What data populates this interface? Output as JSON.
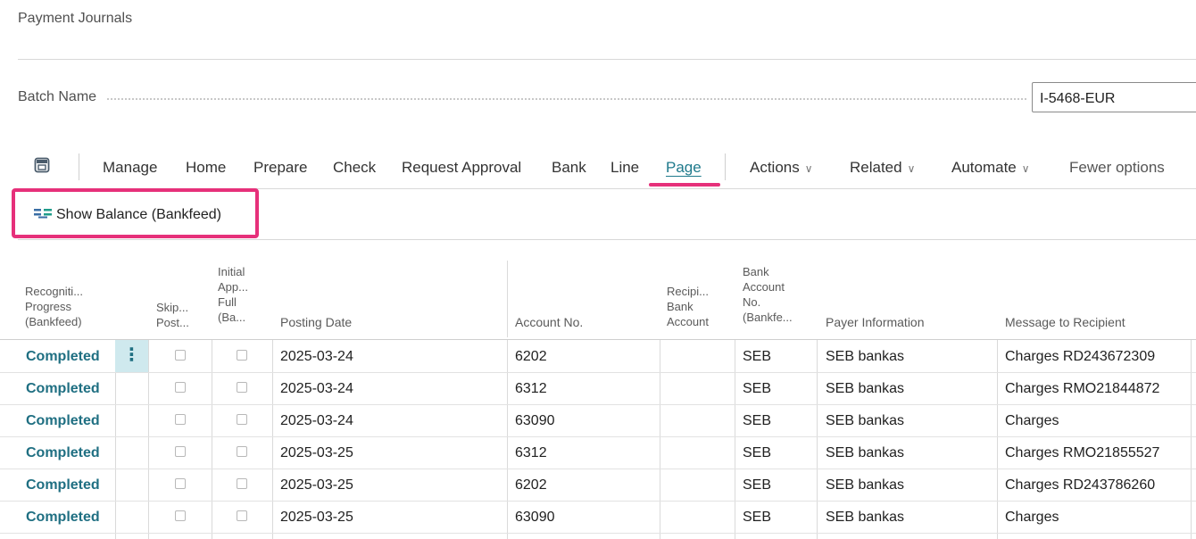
{
  "page": {
    "title": "Payment Journals"
  },
  "batch": {
    "label": "Batch Name",
    "value": "I-5468-EUR"
  },
  "actionbar": {
    "items": [
      "Manage",
      "Home",
      "Prepare",
      "Check",
      "Request Approval",
      "Bank",
      "Line",
      "Page"
    ],
    "dropdowns": [
      "Actions",
      "Related",
      "Automate"
    ],
    "fewer_options": "Fewer options",
    "active": "Page"
  },
  "page_actions": {
    "show_balance": "Show Balance (Bankfeed)"
  },
  "table": {
    "headers": {
      "recognition": [
        "Recogniti...",
        "Progress",
        "(Bankfeed)"
      ],
      "skip": [
        "Skip...",
        "Post..."
      ],
      "initial": [
        "Initial",
        "App...",
        "Full",
        "(Ba..."
      ],
      "posting_date": "Posting Date",
      "account_no": "Account No.",
      "recipient_bank": [
        "Recipi...",
        "Bank",
        "Account"
      ],
      "bank_account": [
        "Bank",
        "Account",
        "No.",
        "(Bankfe..."
      ],
      "payer_info": "Payer Information",
      "message": "Message to Recipient"
    },
    "rows": [
      {
        "status": "Completed",
        "date": "2025-03-24",
        "account": "6202",
        "bank": "SEB",
        "payer": "SEB bankas",
        "message": "Charges RD243672309"
      },
      {
        "status": "Completed",
        "date": "2025-03-24",
        "account": "6312",
        "bank": "SEB",
        "payer": "SEB bankas",
        "message": "Charges RMO21844872"
      },
      {
        "status": "Completed",
        "date": "2025-03-24",
        "account": "63090",
        "bank": "SEB",
        "payer": "SEB bankas",
        "message": "Charges"
      },
      {
        "status": "Completed",
        "date": "2025-03-25",
        "account": "6312",
        "bank": "SEB",
        "payer": "SEB bankas",
        "message": "Charges RMO21855527"
      },
      {
        "status": "Completed",
        "date": "2025-03-25",
        "account": "6202",
        "bank": "SEB",
        "payer": "SEB bankas",
        "message": "Charges RD243786260"
      },
      {
        "status": "Completed",
        "date": "2025-03-25",
        "account": "63090",
        "bank": "SEB",
        "payer": "SEB bankas",
        "message": "Charges"
      }
    ],
    "row_menu": "⋮"
  },
  "colors": {
    "accent": "#1f7a8c",
    "highlight": "#e6307a",
    "status": "#1f6f82"
  }
}
